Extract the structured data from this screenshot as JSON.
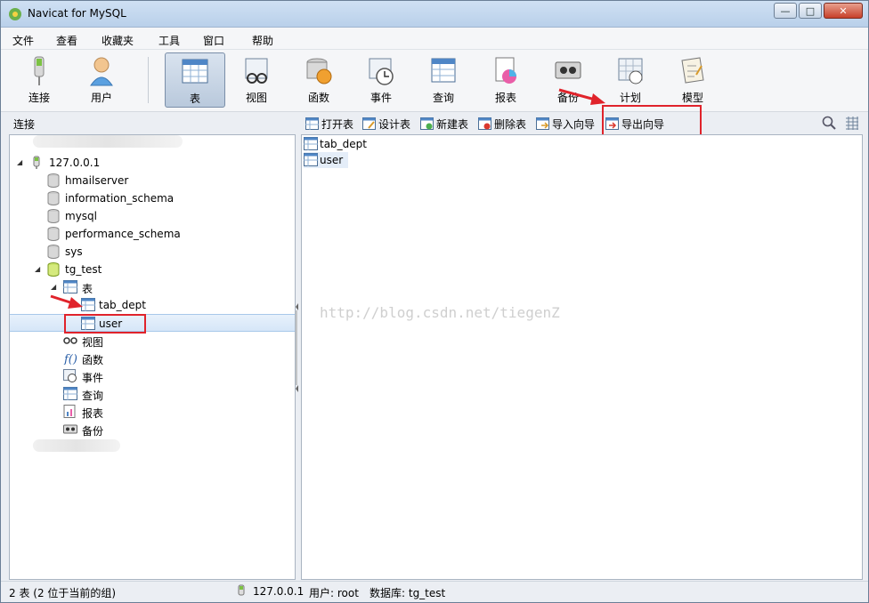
{
  "window": {
    "title": "Navicat for MySQL"
  },
  "menu": [
    "文件",
    "查看",
    "收藏夹",
    "工具",
    "窗口",
    "帮助"
  ],
  "toolbar": {
    "buttons": [
      {
        "label": "连接",
        "icon": "connection-icon"
      },
      {
        "label": "用户",
        "icon": "user-icon"
      },
      {
        "label": "表",
        "icon": "table-icon",
        "active": true
      },
      {
        "label": "视图",
        "icon": "view-icon"
      },
      {
        "label": "函数",
        "icon": "function-icon"
      },
      {
        "label": "事件",
        "icon": "event-icon"
      },
      {
        "label": "查询",
        "icon": "query-icon"
      },
      {
        "label": "报表",
        "icon": "report-icon"
      },
      {
        "label": "备份",
        "icon": "backup-icon"
      },
      {
        "label": "计划",
        "icon": "schedule-icon"
      },
      {
        "label": "模型",
        "icon": "model-icon"
      }
    ]
  },
  "connection_header": "连接",
  "object_toolbar": {
    "open_table": "打开表",
    "design_table": "设计表",
    "new_table": "新建表",
    "delete_table": "删除表",
    "import_wizard": "导入向导",
    "export_wizard": "导出向导"
  },
  "tree": {
    "connection": "127.0.0.1",
    "databases": [
      "hmailserver",
      "information_schema",
      "mysql",
      "performance_schema",
      "sys",
      "tg_test"
    ],
    "tables_node": "表",
    "tables": [
      "tab_dept",
      "user"
    ],
    "categories": [
      "视图",
      "函数",
      "事件",
      "查询",
      "报表",
      "备份"
    ]
  },
  "objects": [
    "tab_dept",
    "user"
  ],
  "watermark": "http://blog.csdn.net/tiegenZ",
  "status": {
    "count": "2 表 (2 位于当前的组)",
    "host": "127.0.0.1",
    "user": "用户: root",
    "database": "数据库: tg_test"
  },
  "colors": {
    "highlight": "#e0232b",
    "selection": "#d6e6f8"
  }
}
